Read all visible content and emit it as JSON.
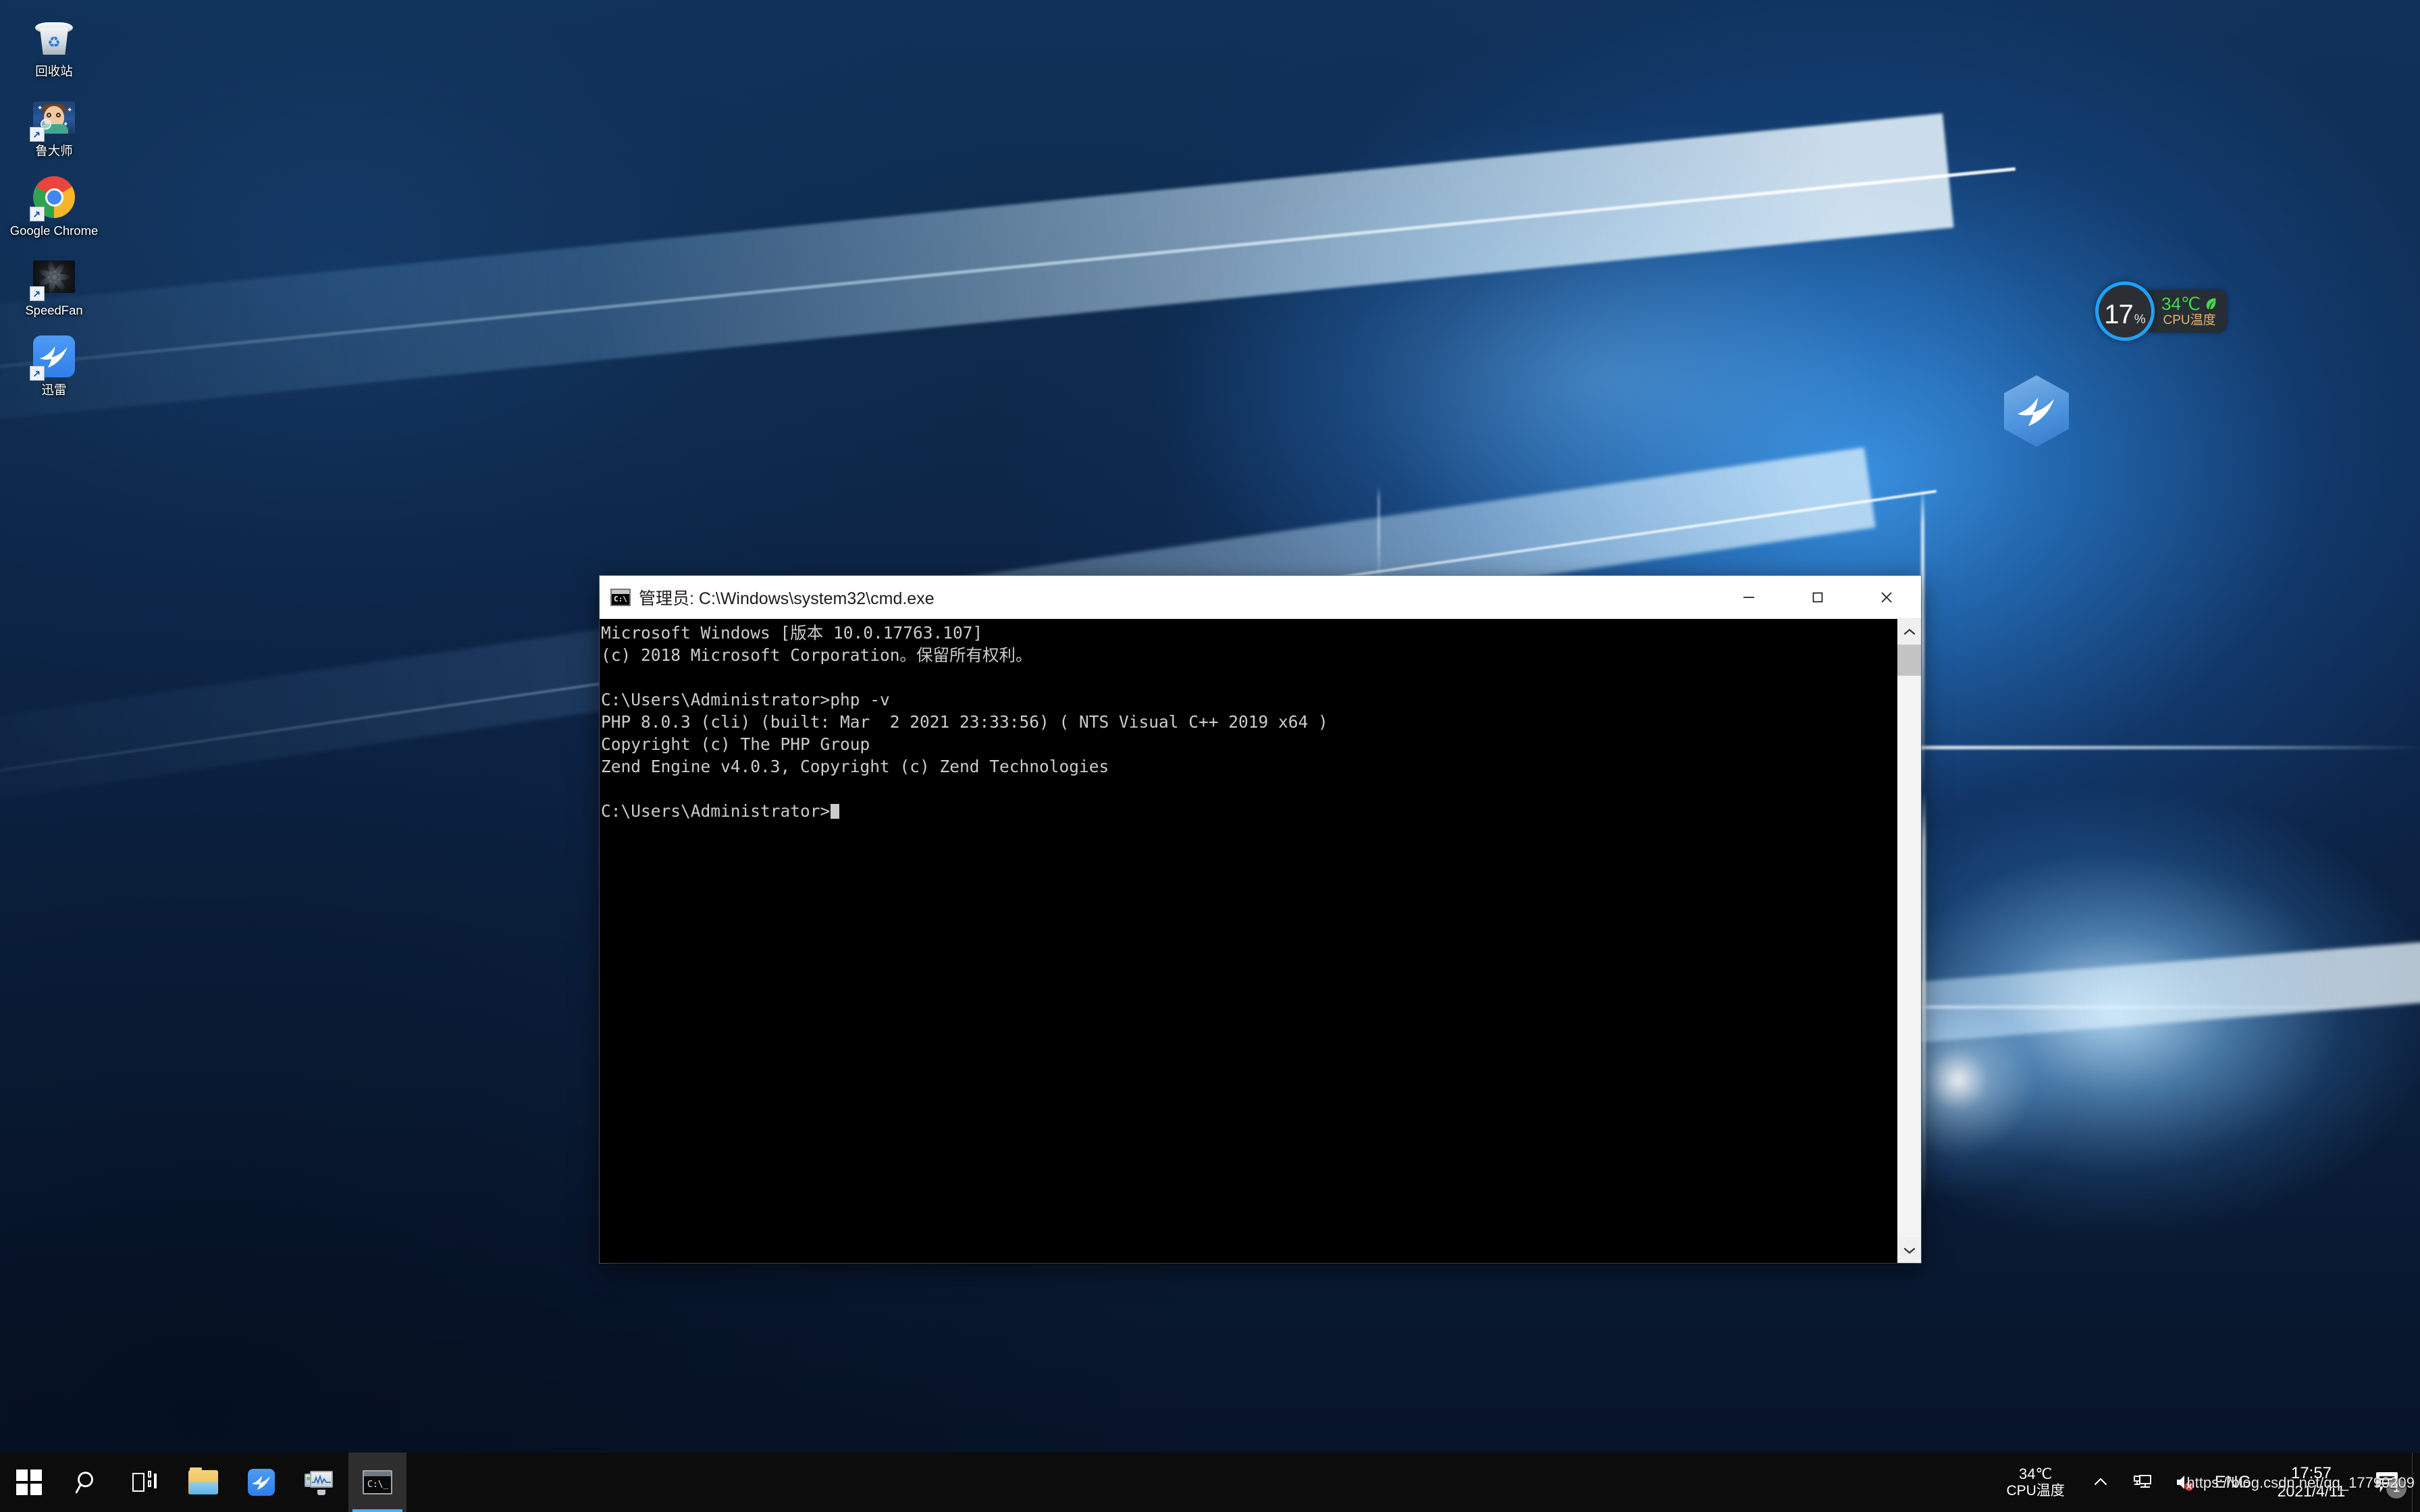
{
  "desktop": {
    "icons": [
      {
        "label": "回收站",
        "icon": "recycle-bin-icon",
        "shortcut": false
      },
      {
        "label": "鲁大师",
        "icon": "ludashi-icon",
        "shortcut": true
      },
      {
        "label": "Google Chrome",
        "icon": "chrome-icon",
        "shortcut": true
      },
      {
        "label": "SpeedFan",
        "icon": "speedfan-icon",
        "shortcut": true
      },
      {
        "label": "迅雷",
        "icon": "thunder-icon",
        "shortcut": true
      }
    ],
    "thunder_widget": {
      "icon": "thunder-hex-icon"
    }
  },
  "cpu_widget": {
    "usage_value": "17",
    "usage_unit": "%",
    "temperature": "34℃",
    "leaf_icon": "leaf-icon",
    "caption": "CPU温度",
    "ring_color": "#1fa2ff",
    "temp_color": "#46d94a",
    "caption_color": "#e9b26b"
  },
  "cmd_window": {
    "icon": "cmd-icon",
    "title": "管理员: C:\\Windows\\system32\\cmd.exe",
    "minimize_label": "minimize",
    "maximize_label": "maximize",
    "close_label": "close",
    "console_text": "Microsoft Windows [版本 10.0.17763.107]\n(c) 2018 Microsoft Corporation。保留所有权利。\n\nC:\\Users\\Administrator>php -v\nPHP 8.0.3 (cli) (built: Mar  2 2021 23:33:56) ( NTS Visual C++ 2019 x64 )\nCopyright (c) The PHP Group\nZend Engine v4.0.3, Copyright (c) Zend Technologies\n\nC:\\Users\\Administrator>",
    "background": "#000000",
    "foreground": "#cccccc",
    "scrollbar": {
      "up_icon": "chevron-up-icon",
      "down_icon": "chevron-down-icon"
    }
  },
  "taskbar": {
    "buttons": [
      {
        "name": "start-button",
        "icon": "windows-logo-icon",
        "active": false
      },
      {
        "name": "search-button",
        "icon": "search-icon",
        "active": false
      },
      {
        "name": "task-view-button",
        "icon": "task-view-icon",
        "active": false
      },
      {
        "name": "file-explorer-button",
        "icon": "folder-icon",
        "active": false
      },
      {
        "name": "thunder-button",
        "icon": "thunder-icon",
        "active": false
      },
      {
        "name": "speedfan-button",
        "icon": "monitor-icon",
        "active": false
      },
      {
        "name": "cmd-button",
        "icon": "cmd-icon",
        "active": true
      }
    ],
    "tray": {
      "cpu_temp": "34℃",
      "cpu_caption": "CPU温度",
      "overflow_icon": "chevron-up-icon",
      "network_icon": "network-icon",
      "volume_icon": "volume-muted-icon",
      "language": "ENG",
      "time": "17:57",
      "date": "2021/4/11",
      "action_center_icon": "action-center-icon",
      "notification_count": "1"
    }
  },
  "watermark": {
    "text": "https://blog.csdn.net/qq_17790209"
  }
}
